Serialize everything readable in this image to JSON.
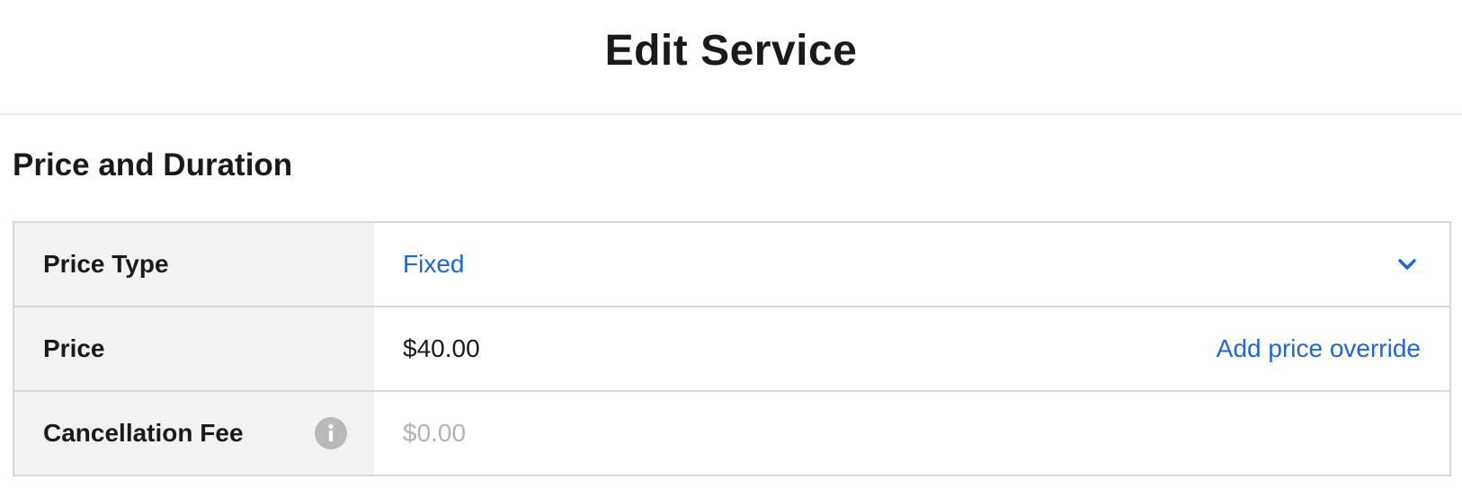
{
  "header": {
    "title": "Edit Service"
  },
  "section": {
    "title": "Price and Duration"
  },
  "form": {
    "price_type": {
      "label": "Price Type",
      "value": "Fixed"
    },
    "price": {
      "label": "Price",
      "value": "$40.00",
      "override_link": "Add price override"
    },
    "cancellation_fee": {
      "label": "Cancellation Fee",
      "placeholder": "$0.00",
      "value": ""
    }
  },
  "icons": {
    "dropdown": "chevron-down-icon",
    "info": "info-icon"
  },
  "colors": {
    "link": "#2067d3",
    "label_background": "#f2f2f2",
    "border": "#d8d8d8",
    "placeholder": "#b3b3b3",
    "info_icon": "#b9b9b9"
  }
}
